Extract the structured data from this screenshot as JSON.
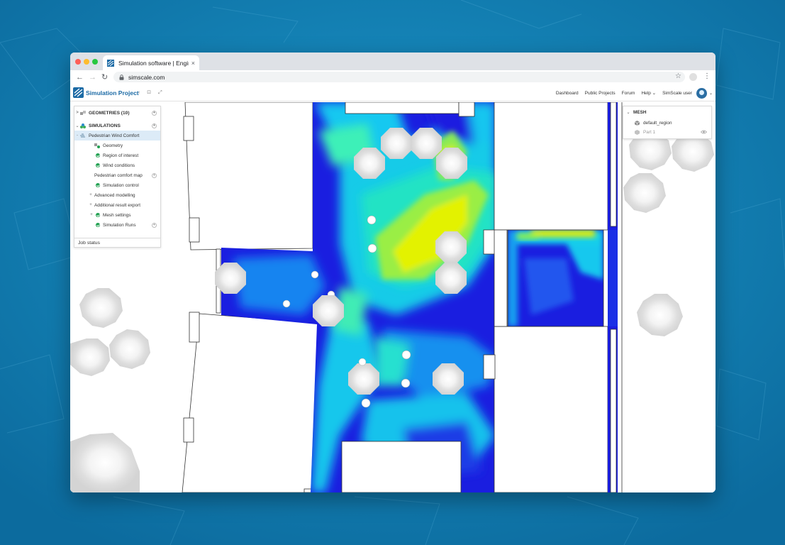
{
  "browser": {
    "tab_title": "Simulation software | Engin",
    "tab_close": "×",
    "url": "simscale.com",
    "back": "←",
    "forward": "→",
    "reload": "↻",
    "star": "☆",
    "menu": "⋮"
  },
  "app": {
    "project_title": "Simulation Project",
    "tools": "‹ ⊡ ⤢",
    "nav": [
      "Dashboard",
      "Public Projects",
      "Forum",
      "Help ⌄",
      "SimScale user"
    ],
    "avatar_caret": "⌄"
  },
  "tree": {
    "geometries": {
      "caret": ">",
      "label": "GEOMETRIES (10)"
    },
    "simulations": {
      "caret": "⌄",
      "label": "SIMULATIONS"
    },
    "simulation_name": "Pedestrian Wind Comfort",
    "items": [
      {
        "label": "Geometry",
        "status": "ok"
      },
      {
        "label": "Region of interest",
        "status": "ok"
      },
      {
        "label": "Wind conditions",
        "status": "ok"
      },
      {
        "label": "Pedestrian comfort map",
        "status": "none"
      },
      {
        "label": "Simulation control",
        "status": "ok"
      },
      {
        "label": "Advanced modelling",
        "status": "none"
      },
      {
        "label": "Additional result export",
        "status": "none"
      },
      {
        "label": "Mesh settings",
        "status": "ok"
      },
      {
        "label": "Simulation Runs",
        "status": "ok"
      }
    ],
    "job_status": "Job status"
  },
  "mesh": {
    "caret": "⌄",
    "header": "MESH",
    "region": "default_region",
    "part": "Part 1"
  },
  "colors": {
    "brand": "#1b6aa5",
    "background": "#137fb4",
    "ok": "#20a050",
    "selected": "#dcebf7"
  }
}
